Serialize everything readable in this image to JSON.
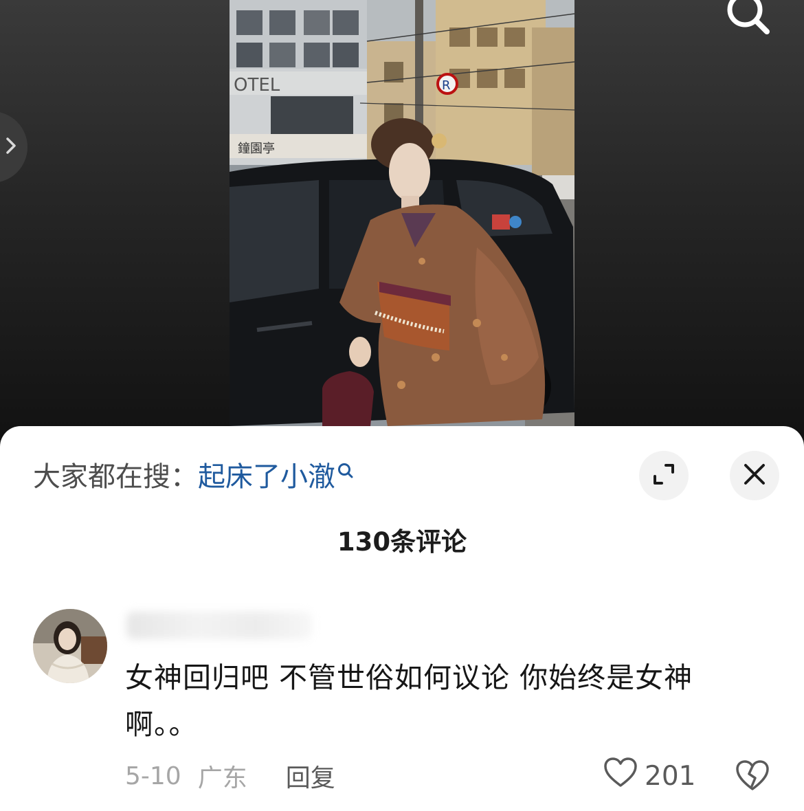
{
  "icons": {
    "side_arrow": "chevron-right-icon",
    "top_search": "search-icon",
    "trend_search": "search-icon",
    "expand": "expand-icon",
    "close": "close-icon",
    "like": "heart-icon",
    "dislike": "broken-heart-icon"
  },
  "colors": {
    "trend_query": "#1f5a9e",
    "meta_gray": "#a6a6a6",
    "sheet_bg": "#ffffff",
    "video_bg": "#262626"
  },
  "photo": {
    "signs": {
      "hotel": "OTEL",
      "shop": "鐘園亭"
    }
  },
  "search_bar": {
    "prefix": "大家都在搜：",
    "query": "起床了小澈"
  },
  "comments_header": {
    "count_text": "130条评论"
  },
  "comment": {
    "text_line1": "女神回归吧 不管世俗如何议论 你始终是女神",
    "text_line2": "啊。。",
    "date": "5-10",
    "location": "广东",
    "reply_label": "回复",
    "like_count": "201"
  }
}
